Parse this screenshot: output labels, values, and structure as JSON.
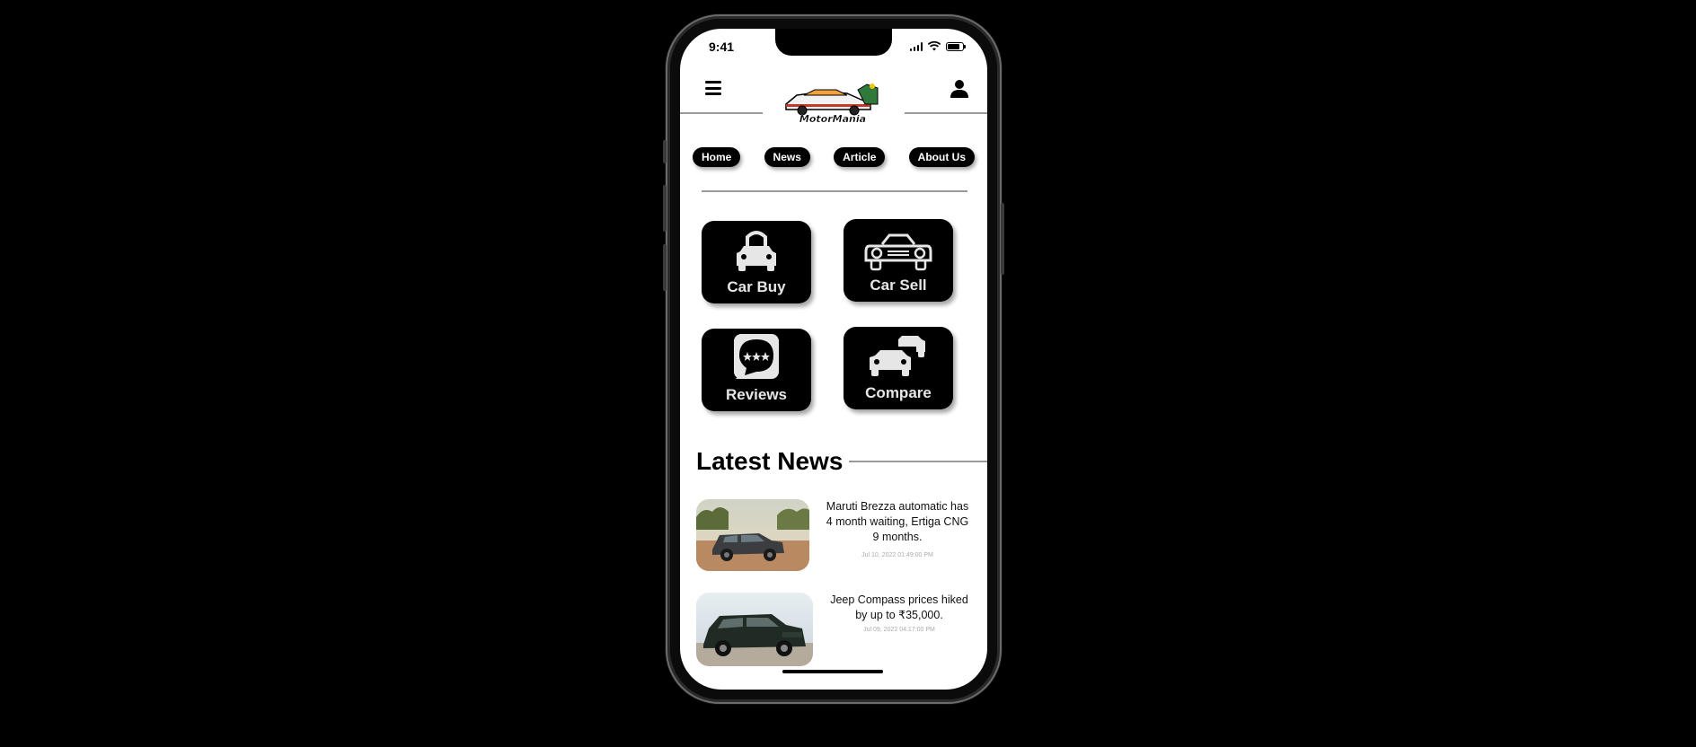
{
  "status_bar": {
    "time": "9:41"
  },
  "header": {
    "logo_text": "MotorMania"
  },
  "nav": [
    {
      "label": "Home"
    },
    {
      "label": "News"
    },
    {
      "label": "Article"
    },
    {
      "label": "About Us"
    }
  ],
  "tiles": [
    {
      "label": "Car Buy",
      "icon": "car-buy-icon"
    },
    {
      "label": "Car Sell",
      "icon": "car-sell-icon"
    },
    {
      "label": "Reviews",
      "icon": "reviews-icon"
    },
    {
      "label": "Compare",
      "icon": "compare-icon"
    }
  ],
  "latest_news": {
    "title": "Latest News",
    "items": [
      {
        "headline": "Maruti Brezza automatic has 4 month waiting, Ertiga CNG 9 months.",
        "date": "Jul 10, 2022 01:49:00 PM"
      },
      {
        "headline": "Jeep Compass prices hiked by up to ₹35,000.",
        "date": "Jul 09, 2022 04:17:00 PM"
      }
    ]
  },
  "colors": {
    "background": "#000000",
    "screen": "#ffffff",
    "accent": "#000000",
    "tile_text": "#e6e6e6"
  }
}
